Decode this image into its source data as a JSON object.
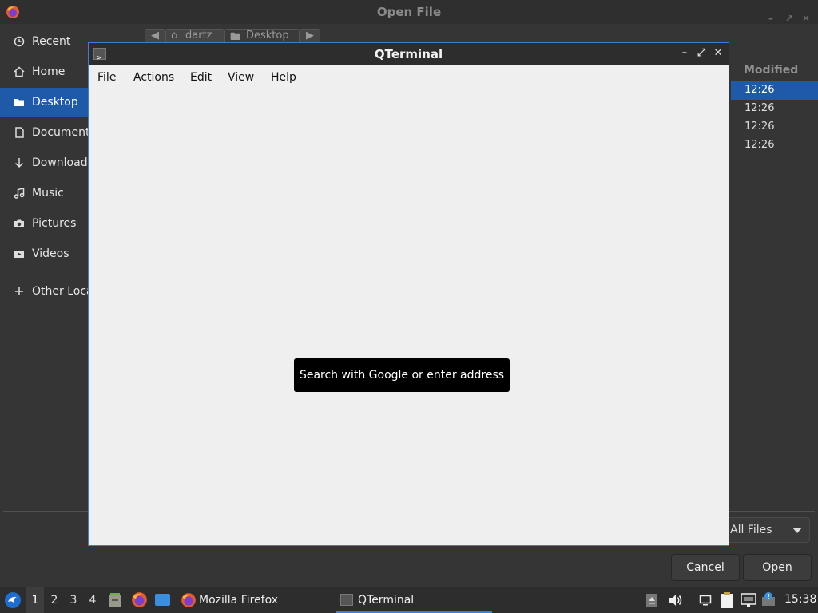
{
  "dialog": {
    "title": "Open File",
    "breadcrumbs": [
      "dartz",
      "Desktop"
    ],
    "sidebar": [
      {
        "label": "Recent",
        "icon": "clock-icon"
      },
      {
        "label": "Home",
        "icon": "home-icon"
      },
      {
        "label": "Desktop",
        "icon": "folder-icon",
        "active": true
      },
      {
        "label": "Documents",
        "icon": "document-icon"
      },
      {
        "label": "Downloads",
        "icon": "download-arrow-icon"
      },
      {
        "label": "Music",
        "icon": "music-note-icon"
      },
      {
        "label": "Pictures",
        "icon": "camera-icon"
      },
      {
        "label": "Videos",
        "icon": "video-icon"
      },
      {
        "label": "Other Locations",
        "icon": "plus-icon"
      }
    ],
    "column_header": "Modified",
    "modified_times": [
      "12:26",
      "12:26",
      "12:26",
      "12:26"
    ],
    "filter": "All Files",
    "cancel_label": "Cancel",
    "open_label": "Open"
  },
  "terminal": {
    "title": "QTerminal",
    "menu": [
      "File",
      "Actions",
      "Edit",
      "View",
      "Help"
    ],
    "tooltip": "Search with Google or enter address"
  },
  "taskbar": {
    "workspaces": [
      "1",
      "2",
      "3",
      "4"
    ],
    "active_workspace": "1",
    "tasks": [
      {
        "label": "Mozilla Firefox",
        "icon": "firefox-icon"
      },
      {
        "label": "QTerminal",
        "icon": "terminal-icon",
        "active": true
      }
    ],
    "clock": "15:38"
  },
  "colors": {
    "accent": "#1e5aa8",
    "window_border": "#3c7fd8"
  }
}
